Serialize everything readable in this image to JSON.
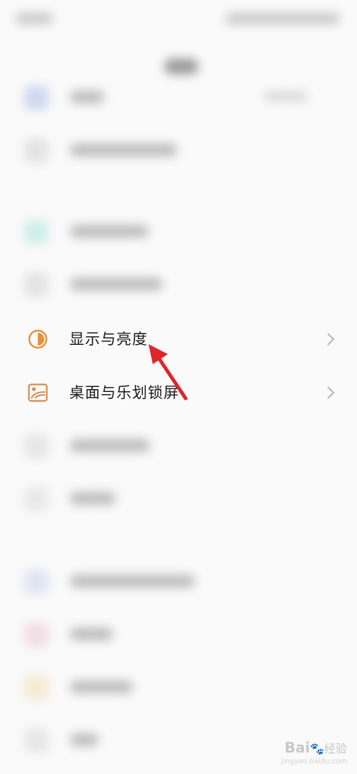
{
  "settings": {
    "items": [
      {
        "label": "显示与亮度",
        "icon": "half-circle-brightness-icon",
        "color": "#e6913d"
      },
      {
        "label": "桌面与乐划锁屏",
        "icon": "wallpaper-icon",
        "color": "#d98a4a"
      }
    ]
  },
  "watermark": {
    "brand": "Bai",
    "brand_suffix": "经验",
    "url": "jingyan.baidu.com"
  },
  "colors": {
    "annotation_arrow": "#e0252b",
    "accent": "#e6913d"
  }
}
